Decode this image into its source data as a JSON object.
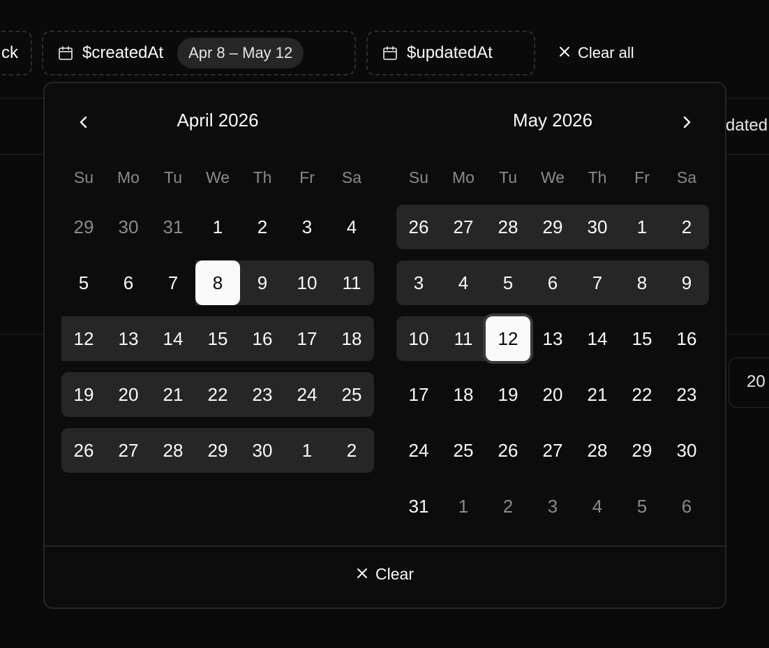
{
  "filters": {
    "left_chip_label": "ck",
    "created": {
      "label": "$createdAt",
      "value": "Apr 8 – May 12"
    },
    "updated": {
      "label": "$updatedAt"
    },
    "clear_all_label": "Clear all"
  },
  "background": {
    "header_partial": "dated",
    "cell_partial": "20"
  },
  "calendar": {
    "weekdays": [
      "Su",
      "Mo",
      "Tu",
      "We",
      "Th",
      "Fr",
      "Sa"
    ],
    "months": [
      {
        "caption": "April 2026",
        "weeks": [
          [
            "29",
            "30",
            "31",
            "1",
            "2",
            "3",
            "4"
          ],
          [
            "5",
            "6",
            "7",
            "8",
            "9",
            "10",
            "11"
          ],
          [
            "12",
            "13",
            "14",
            "15",
            "16",
            "17",
            "18"
          ],
          [
            "19",
            "20",
            "21",
            "22",
            "23",
            "24",
            "25"
          ],
          [
            "26",
            "27",
            "28",
            "29",
            "30",
            "1",
            "2"
          ]
        ]
      },
      {
        "caption": "May 2026",
        "weeks": [
          [
            "26",
            "27",
            "28",
            "29",
            "30",
            "1",
            "2"
          ],
          [
            "3",
            "4",
            "5",
            "6",
            "7",
            "8",
            "9"
          ],
          [
            "10",
            "11",
            "12",
            "13",
            "14",
            "15",
            "16"
          ],
          [
            "17",
            "18",
            "19",
            "20",
            "21",
            "22",
            "23"
          ],
          [
            "24",
            "25",
            "26",
            "27",
            "28",
            "29",
            "30"
          ],
          [
            "31",
            "1",
            "2",
            "3",
            "4",
            "5",
            "6"
          ]
        ]
      }
    ],
    "clear_label": "Clear"
  },
  "colors": {
    "background": "#0a0a0a",
    "range_fill": "#262626",
    "selected_fill": "#fafafa",
    "muted_text": "#8a8a8a"
  }
}
